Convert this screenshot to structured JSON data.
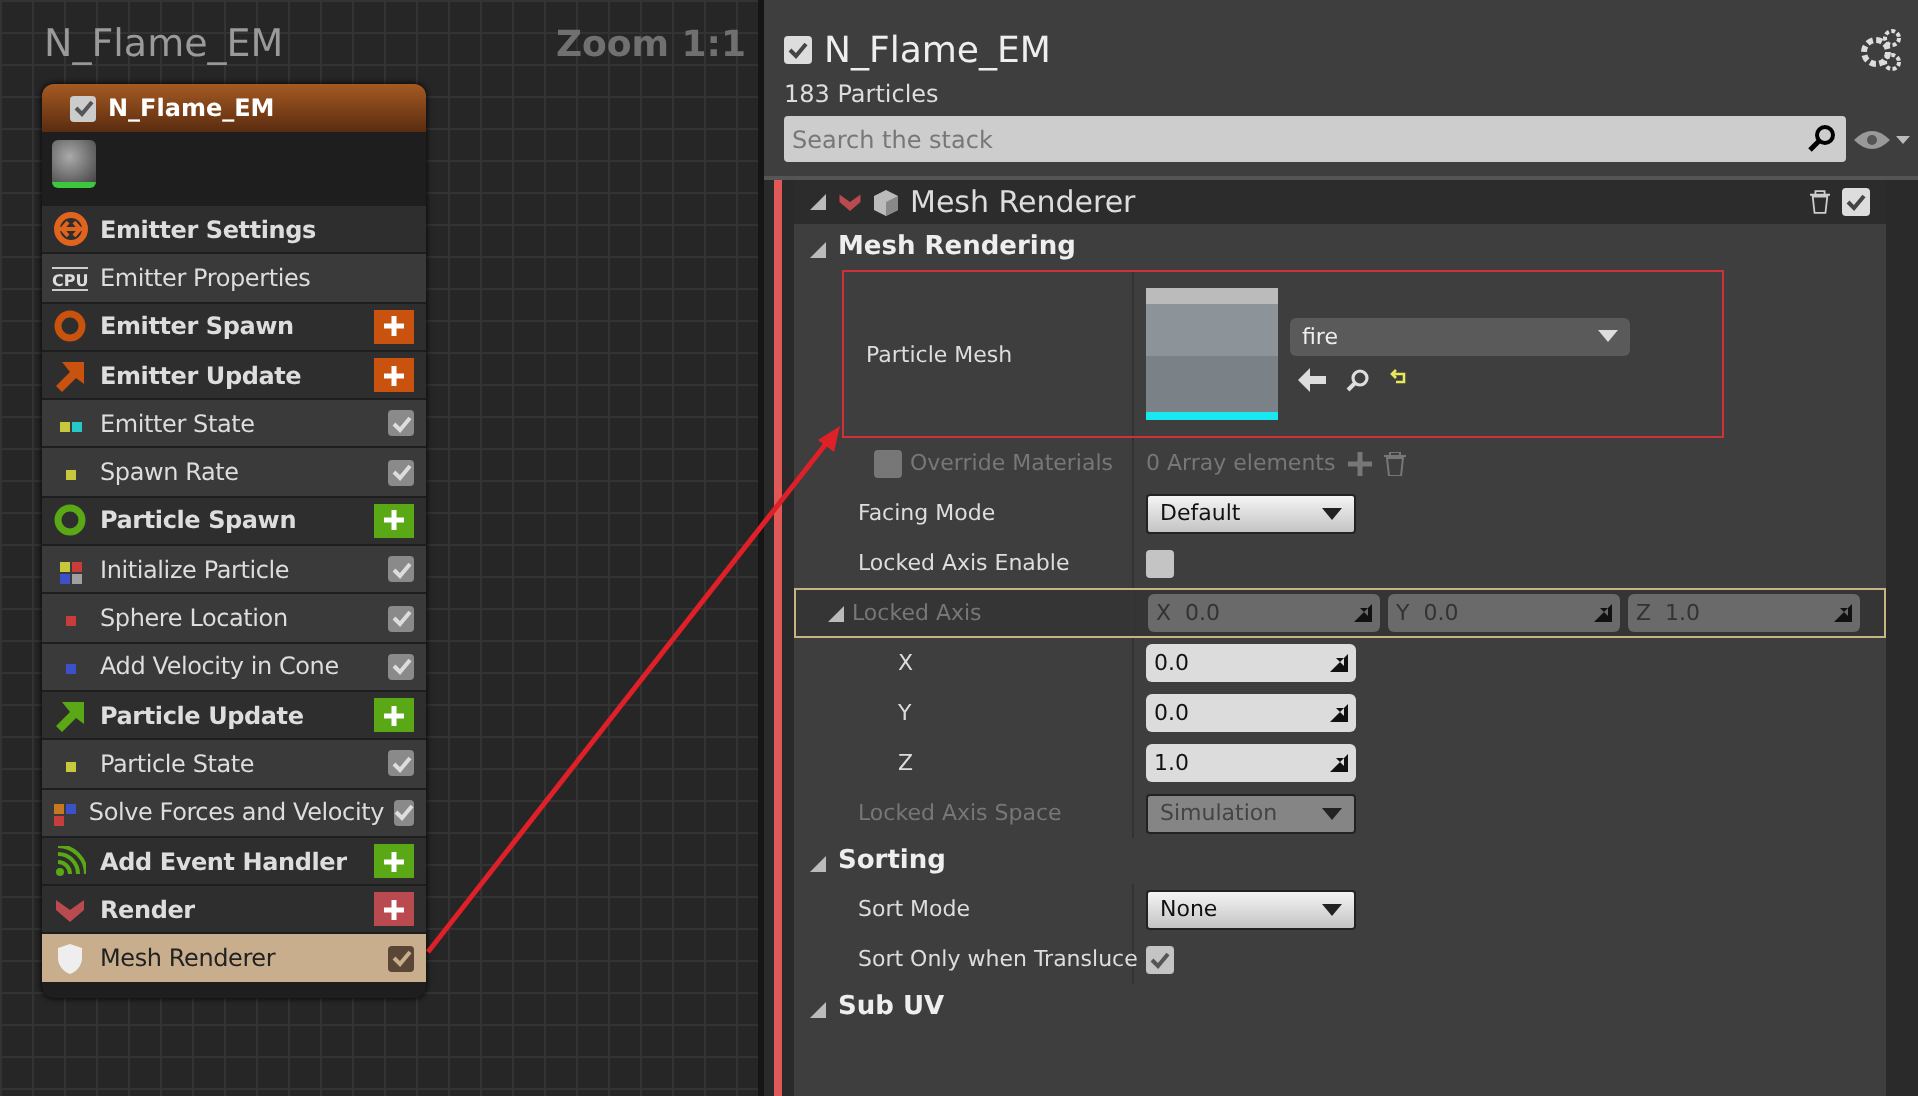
{
  "graph": {
    "title": "N_Flame_EM",
    "zoom": "Zoom 1:1",
    "node": {
      "title": "N_Flame_EM",
      "enabled": true,
      "items": [
        {
          "kind": "settings",
          "label": "Emitter Settings",
          "selected": false
        },
        {
          "kind": "properties",
          "label": "Emitter Properties",
          "icon_text": "CPU",
          "selected": false
        },
        {
          "kind": "spawn",
          "label": "Emitter Spawn",
          "color": "#c8520e",
          "selected": false
        },
        {
          "kind": "update",
          "label": "Emitter Update",
          "color": "#c8520e",
          "selected": false
        },
        {
          "kind": "module",
          "label": "Emitter State",
          "checked": true,
          "dots": [
            {
              "color": "#c8c83c"
            },
            {
              "color": "#28c8c8"
            }
          ],
          "selected": false
        },
        {
          "kind": "module",
          "label": "Spawn Rate",
          "checked": true,
          "dots": [
            {
              "color": "#c8c83c"
            }
          ],
          "selected": false
        },
        {
          "kind": "spawn",
          "label": "Particle Spawn",
          "color": "#5aa816",
          "selected": false
        },
        {
          "kind": "module",
          "label": "Initialize Particle",
          "checked": true,
          "dots": [
            {
              "color": "#c8c83c"
            },
            {
              "color": "#c83c3c"
            },
            {
              "color": "#3c50c8"
            },
            {
              "color": "#a0a0a0"
            }
          ],
          "selected": false
        },
        {
          "kind": "module",
          "label": "Sphere Location",
          "checked": true,
          "dots": [
            {
              "color": "#c83c3c"
            }
          ],
          "selected": false
        },
        {
          "kind": "module",
          "label": "Add Velocity in Cone",
          "checked": true,
          "dots": [
            {
              "color": "#3c50c8"
            }
          ],
          "selected": false
        },
        {
          "kind": "update",
          "label": "Particle Update",
          "color": "#5aa816",
          "selected": false
        },
        {
          "kind": "module",
          "label": "Particle State",
          "checked": true,
          "dots": [
            {
              "color": "#c8c83c"
            }
          ],
          "selected": false
        },
        {
          "kind": "module",
          "label": "Solve Forces and Velocity",
          "checked": true,
          "dots": [
            {
              "color": "#c8781e"
            },
            {
              "color": "#3c50c8"
            },
            {
              "color": "#c83c3c"
            }
          ],
          "selected": false
        },
        {
          "kind": "event",
          "label": "Add Event Handler",
          "color": "#5aa816",
          "selected": false
        },
        {
          "kind": "render",
          "label": "Render",
          "color": "#b84a50",
          "selected": false
        },
        {
          "kind": "module",
          "label": "Mesh Renderer",
          "checked": true,
          "selected": true
        }
      ]
    }
  },
  "stack": {
    "enabled": true,
    "title": "N_Flame_EM",
    "particles": "183 Particles",
    "search": {
      "placeholder": "Search the stack"
    },
    "renderer": {
      "title": "Mesh Renderer",
      "enabled": true,
      "groups": [
        {
          "title": "Mesh Rendering",
          "expanded": true,
          "rows": [
            {
              "kind": "mesh",
              "label": "Particle Mesh",
              "value": "fire",
              "annotated": true
            },
            {
              "kind": "array",
              "label": "Override Materials",
              "checked": false,
              "disabled": true,
              "value": "0 Array elements"
            },
            {
              "kind": "dropdown",
              "label": "Facing Mode",
              "value": "Default",
              "disabled": false
            },
            {
              "kind": "checkbox",
              "label": "Locked Axis Enable",
              "checked": false
            },
            {
              "kind": "vector",
              "label": "Locked Axis",
              "expanded": true,
              "highlighted": true,
              "disabled": true,
              "values": [
                {
                  "axis": "X",
                  "value": "0.0"
                },
                {
                  "axis": "Y",
                  "value": "0.0"
                },
                {
                  "axis": "Z",
                  "value": "1.0"
                }
              ],
              "children": [
                {
                  "label": "X",
                  "value": "0.0"
                },
                {
                  "label": "Y",
                  "value": "0.0"
                },
                {
                  "label": "Z",
                  "value": "1.0"
                }
              ]
            },
            {
              "kind": "dropdown",
              "label": "Locked Axis Space",
              "value": "Simulation",
              "disabled": true
            }
          ]
        },
        {
          "title": "Sorting",
          "expanded": true,
          "rows": [
            {
              "kind": "dropdown",
              "label": "Sort Mode",
              "value": "None",
              "disabled": false
            },
            {
              "kind": "checkbox",
              "label": "Sort Only when Transluce",
              "checked": true
            }
          ]
        },
        {
          "title": "Sub UV",
          "expanded": true
        }
      ]
    }
  }
}
